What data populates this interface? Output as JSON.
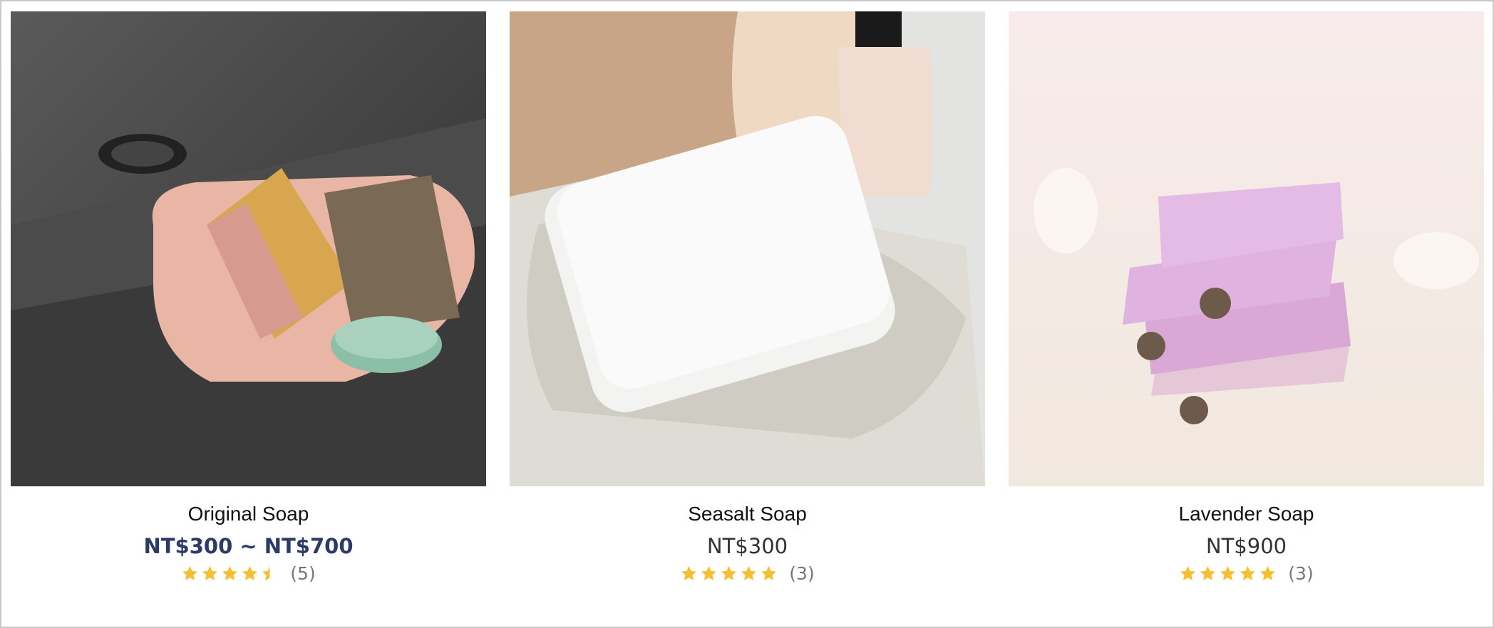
{
  "products": [
    {
      "name": "Original Soap",
      "price": "NT$300 ~ NT$700",
      "price_style": "range",
      "rating": 4.5,
      "review_count": "(5)",
      "image": "original-soap-photo"
    },
    {
      "name": "Seasalt Soap",
      "price": "NT$300",
      "price_style": "single",
      "rating": 5,
      "review_count": "(3)",
      "image": "seasalt-soap-photo"
    },
    {
      "name": "Lavender Soap",
      "price": "NT$900",
      "price_style": "single",
      "rating": 5,
      "review_count": "(3)",
      "image": "lavender-soap-photo"
    }
  ],
  "colors": {
    "star": "#f5bf2f",
    "price_range": "#2b3a67",
    "price": "#333333",
    "review_count": "#777777"
  }
}
